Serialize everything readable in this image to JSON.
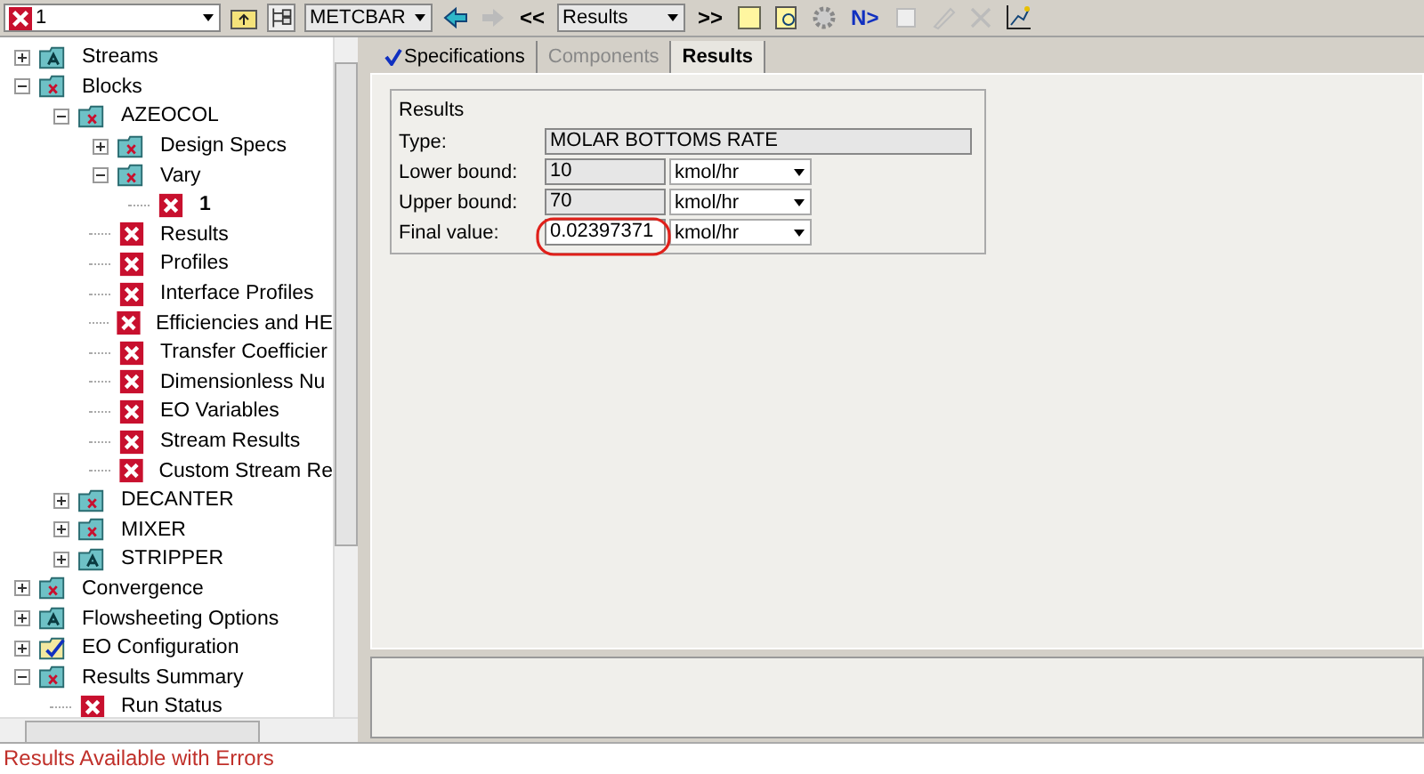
{
  "toolbar": {
    "item_selector": "1",
    "block_selector": "METCBAR",
    "form_selector": "Results",
    "prev_label": "<<",
    "next_label": ">>",
    "next_input_label": "N>"
  },
  "tree": [
    {
      "label": "Streams",
      "kind": "folder",
      "expanded": false
    },
    {
      "label": "Blocks",
      "kind": "errorfolder",
      "expanded": true,
      "children": [
        {
          "label": "AZEOCOL",
          "kind": "errorfolder",
          "expanded": true,
          "children": [
            {
              "label": "Design Specs",
              "kind": "errorfolder",
              "expanded": false
            },
            {
              "label": "Vary",
              "kind": "errorfolder",
              "expanded": true,
              "children": [
                {
                  "label": "1",
                  "kind": "error",
                  "bold": true
                }
              ]
            },
            {
              "label": "Results",
              "kind": "error"
            },
            {
              "label": "Profiles",
              "kind": "error"
            },
            {
              "label": "Interface Profiles",
              "kind": "error"
            },
            {
              "label": "Efficiencies and HE",
              "kind": "error"
            },
            {
              "label": "Transfer Coefficier",
              "kind": "error"
            },
            {
              "label": "Dimensionless Nu",
              "kind": "error"
            },
            {
              "label": "EO Variables",
              "kind": "error"
            },
            {
              "label": "Stream Results",
              "kind": "error"
            },
            {
              "label": "Custom Stream Re",
              "kind": "error"
            }
          ]
        },
        {
          "label": "DECANTER",
          "kind": "errorfolder",
          "expanded": false
        },
        {
          "label": "MIXER",
          "kind": "errorfolder",
          "expanded": false
        },
        {
          "label": "STRIPPER",
          "kind": "folder",
          "expanded": false
        }
      ]
    },
    {
      "label": "Convergence",
      "kind": "errorfolder",
      "expanded": false
    },
    {
      "label": "Flowsheeting Options",
      "kind": "folder",
      "expanded": false
    },
    {
      "label": "EO Configuration",
      "kind": "checkfolder",
      "expanded": false
    },
    {
      "label": "Results Summary",
      "kind": "errorfolder",
      "expanded": true,
      "children": [
        {
          "label": "Run Status",
          "kind": "error"
        }
      ]
    }
  ],
  "tabs": [
    {
      "label": "Specifications",
      "selected": false,
      "complete": true,
      "disabled": false
    },
    {
      "label": "Components",
      "selected": false,
      "complete": false,
      "disabled": true
    },
    {
      "label": "Results",
      "selected": true,
      "complete": false,
      "disabled": false
    }
  ],
  "results": {
    "title": "Results",
    "type_label": "Type:",
    "type_value": "MOLAR BOTTOMS RATE",
    "rows": [
      {
        "label": "Lower bound:",
        "value": "10",
        "unit": "kmol/hr"
      },
      {
        "label": "Upper bound:",
        "value": "70",
        "unit": "kmol/hr"
      },
      {
        "label": "Final value:",
        "value": "0.02397371",
        "unit": "kmol/hr"
      }
    ]
  },
  "status_bar": "Results Available with Errors"
}
